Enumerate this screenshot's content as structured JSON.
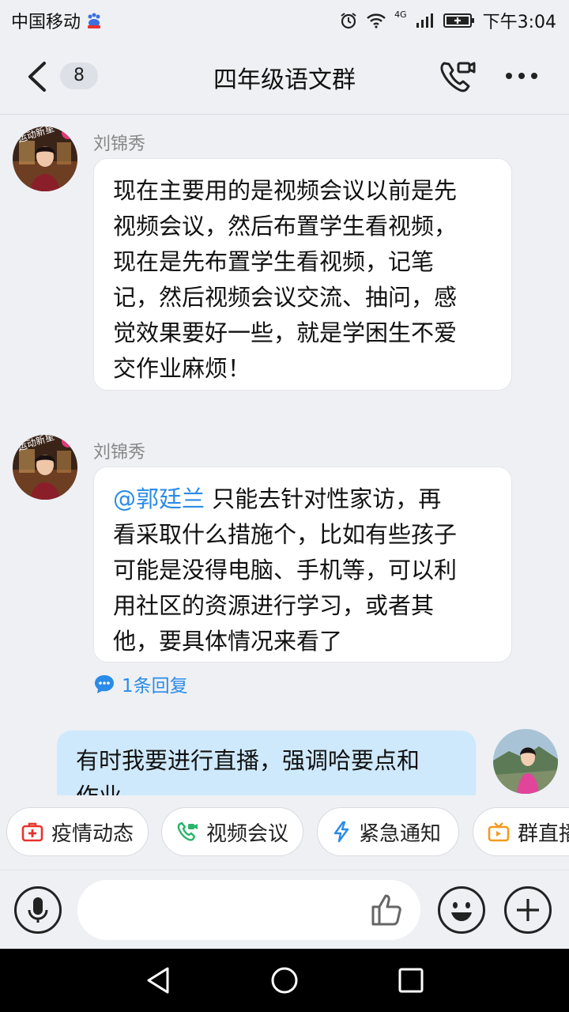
{
  "status_bar": {
    "carrier": "中国移动",
    "network": "4G",
    "time": "下午3:04"
  },
  "header": {
    "unread_count": "8",
    "title": "四年级语文群"
  },
  "messages": [
    {
      "sender": "刘锦秀",
      "avatar_badge": "运动新星",
      "text_lines": [
        "现在主要用的是视频会议以前是先",
        "视频会议，然后布置学生看视频，",
        "现在是先布置学生看视频，记笔",
        "记，然后视频会议交流、抽问，感",
        "觉效果要好一些，就是学困生不爱",
        "交作业麻烦！"
      ]
    },
    {
      "sender": "刘锦秀",
      "avatar_badge": "运动新星",
      "mention": "@郭廷兰",
      "text_lines": [
        " 只能去针对性家访，再",
        "看采取什么措施个，比如有些孩子",
        "可能是没得电脑、手机等，可以利",
        "用社区的资源进行学习，或者其",
        "他，要具体情况来看了"
      ],
      "reply_count_label": "1条回复"
    }
  ],
  "my_message": {
    "text_lines": [
      "有时我要进行直播，强调哈要点和",
      "作业"
    ]
  },
  "quick_actions": [
    {
      "label": "疫情动态",
      "icon": "medical-kit-icon",
      "color": "#e8322f"
    },
    {
      "label": "视频会议",
      "icon": "video-call-icon",
      "color": "#2ab46a"
    },
    {
      "label": "紧急通知",
      "icon": "lightning-icon",
      "color": "#2b8be8"
    },
    {
      "label": "群直播",
      "icon": "tv-icon",
      "color": "#f39a1e"
    }
  ],
  "colors": {
    "accent": "#2b8be8",
    "my_bubble": "#cfe9fc",
    "background": "#eef0f4"
  }
}
